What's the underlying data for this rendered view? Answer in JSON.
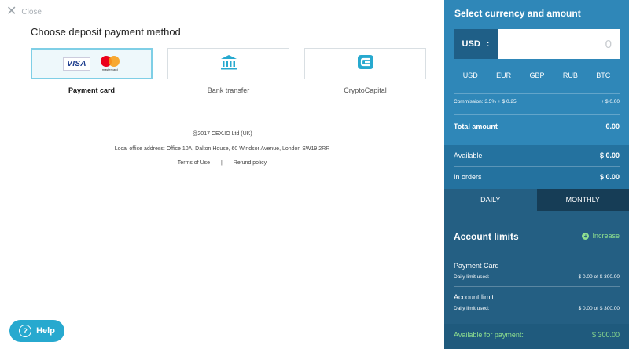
{
  "close_label": "Close",
  "heading": "Choose deposit payment method",
  "methods": [
    {
      "label": "Payment card",
      "visa_text": "VISA",
      "mastercard_text": "mastercard"
    },
    {
      "label": "Bank transfer",
      "icon": "bank-icon"
    },
    {
      "label": "CryptoCapital",
      "icon": "cryptocapital-icon"
    }
  ],
  "footer": {
    "copyright": "@2017 CEX.IO Ltd (UK)",
    "address": "Local office address: Office 10A, Dalton House, 60 Windsor Avenue, London SW19 2RR",
    "terms": "Terms of Use",
    "separator": "|",
    "refund": "Refund policy"
  },
  "help_label": "Help",
  "panel": {
    "title": "Select currency and amount",
    "currency_code": "USD",
    "currency_colon": ":",
    "amount_placeholder": "0",
    "currencies": [
      "USD",
      "EUR",
      "GBP",
      "RUB",
      "BTC"
    ],
    "commission_label": "Commission: 3.5% + $ 0.25",
    "commission_value": "+ $ 0.00",
    "total_label": "Total amount",
    "total_value": "0.00",
    "available_label": "Available",
    "available_value": "$ 0.00",
    "in_orders_label": "In orders",
    "in_orders_value": "$ 0.00",
    "tab_daily": "DAILY",
    "tab_monthly": "MONTHLY",
    "limits_title": "Account limits",
    "increase_label": "Increase",
    "payment_card_title": "Payment Card",
    "payment_card_daily_label": "Daily limit used:",
    "payment_card_daily_value": "$ 0.00 of $ 300.00",
    "account_limit_title": "Account limit",
    "account_limit_daily_label": "Daily limit used:",
    "account_limit_daily_value": "$ 0.00 of $ 300.00",
    "available_payment_label": "Available for payment:",
    "available_payment_value": "$ 300.00"
  },
  "colors": {
    "panel_top": "#2f87b8",
    "panel_mid": "#24729f",
    "panel_bottom": "#245f83",
    "tab_monthly": "#163d56",
    "accent_green": "#8fe08f",
    "help_button": "#27a9cf",
    "selected_border": "#7fcfe6"
  }
}
